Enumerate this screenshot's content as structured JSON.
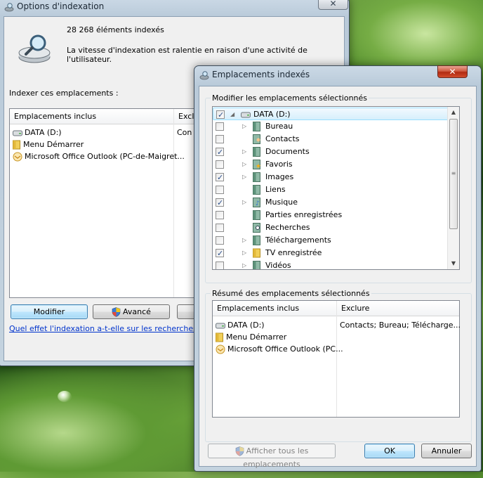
{
  "background": {
    "colors": {
      "bright": "#9fc46a",
      "dark": "#1e4a14"
    }
  },
  "options_window": {
    "title": "Options d'indexation",
    "count": "28 268 éléments indexés",
    "status": "La vitesse d'indexation est ralentie en raison d'une activité de l'utilisateur.",
    "section_label": "Indexer ces emplacements :",
    "columns": {
      "included": "Emplacements inclus",
      "excluded": "Exclu"
    },
    "rows": [
      {
        "name": "DATA (D:)",
        "icon": "drive-icon",
        "excluded": "Con"
      },
      {
        "name": "Menu Démarrer",
        "icon": "folder-icon",
        "excluded": ""
      },
      {
        "name": "Microsoft Office Outlook (PC-de-Maigret...",
        "icon": "outlook-icon",
        "excluded": ""
      }
    ],
    "buttons": {
      "modify": "Modifier",
      "advanced": "Avancé"
    },
    "help_link": "Quel effet l'indexation a-t-elle sur les recherches ?"
  },
  "dialog": {
    "title": "Emplacements indexés",
    "modify_group_label": "Modifier les emplacements sélectionnés",
    "tree": [
      {
        "label": "DATA (D:)",
        "checked": true,
        "expander": "◢",
        "icon": "drive-icon",
        "level": 0,
        "selected": true
      },
      {
        "label": "Bureau",
        "checked": false,
        "expander": "▷",
        "icon": "folder-green-icon",
        "level": 1
      },
      {
        "label": "Contacts",
        "checked": false,
        "expander": "",
        "icon": "contacts-icon",
        "level": 1
      },
      {
        "label": "Documents",
        "checked": true,
        "expander": "▷",
        "icon": "folder-green-icon",
        "level": 1
      },
      {
        "label": "Favoris",
        "checked": false,
        "expander": "▷",
        "icon": "favorites-icon",
        "level": 1
      },
      {
        "label": "Images",
        "checked": true,
        "expander": "▷",
        "icon": "folder-green-icon",
        "level": 1
      },
      {
        "label": "Liens",
        "checked": false,
        "expander": "",
        "icon": "folder-green-icon",
        "level": 1
      },
      {
        "label": "Musique",
        "checked": true,
        "expander": "▷",
        "icon": "music-icon",
        "level": 1
      },
      {
        "label": "Parties enregistrées",
        "checked": false,
        "expander": "",
        "icon": "folder-green-icon",
        "level": 1
      },
      {
        "label": "Recherches",
        "checked": false,
        "expander": "",
        "icon": "search-folder-icon",
        "level": 1
      },
      {
        "label": "Téléchargements",
        "checked": false,
        "expander": "▷",
        "icon": "folder-green-icon",
        "level": 1
      },
      {
        "label": "TV enregistrée",
        "checked": true,
        "expander": "▷",
        "icon": "folder-yellow-icon",
        "level": 1
      },
      {
        "label": "Vidéos",
        "checked": false,
        "expander": "▷",
        "icon": "folder-green-icon",
        "level": 1
      }
    ],
    "summary_group_label": "Résumé des emplacements sélectionnés",
    "summary_columns": {
      "included": "Emplacements inclus",
      "excluded": "Exclure"
    },
    "summary_rows": [
      {
        "name": "DATA (D:)",
        "icon": "drive-icon",
        "excluded": "Contacts; Bureau; Télécharge..."
      },
      {
        "name": "Menu Démarrer",
        "icon": "folder-icon",
        "excluded": ""
      },
      {
        "name": "Microsoft Office Outlook (PC...",
        "icon": "outlook-icon",
        "excluded": ""
      }
    ],
    "buttons": {
      "show_all": "Afficher tous les emplacements",
      "ok": "OK",
      "cancel": "Annuler"
    }
  }
}
